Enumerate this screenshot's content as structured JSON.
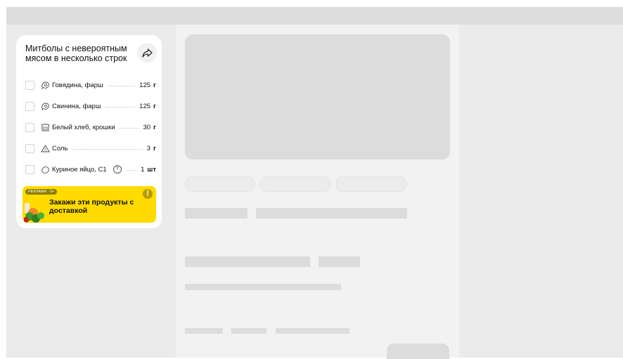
{
  "recipe": {
    "title": "Митболы с невероятным мясом в несколько строк",
    "share_icon": "share-arrow-icon",
    "ingredients": [
      {
        "name": "Говядина, фарш",
        "amount": "125",
        "unit": "г",
        "icon": "meat-icon",
        "help": ""
      },
      {
        "name": "Свинина, фарш",
        "amount": "125",
        "unit": "г",
        "icon": "meat-icon",
        "help": ""
      },
      {
        "name": "Белый хлеб, крошки",
        "amount": "30",
        "unit": "г",
        "icon": "bread-icon",
        "help": ""
      },
      {
        "name": "Соль",
        "amount": "3",
        "unit": "г",
        "icon": "salt-icon",
        "help": ""
      },
      {
        "name": "Куриное яйцо, С1",
        "amount": "1",
        "unit": "шт",
        "icon": "egg-icon",
        "help": "?"
      }
    ]
  },
  "ad": {
    "badge": "РЕКЛАМА · 0+",
    "text": "Закажи эти продукты с доставкой",
    "more": "⋮",
    "background": "#ffdb00"
  },
  "colors": {
    "page": "#ebebeb",
    "topbar": "#dcdcdc",
    "content": "#f2f2f2",
    "skeleton": "#dcdcdc"
  }
}
